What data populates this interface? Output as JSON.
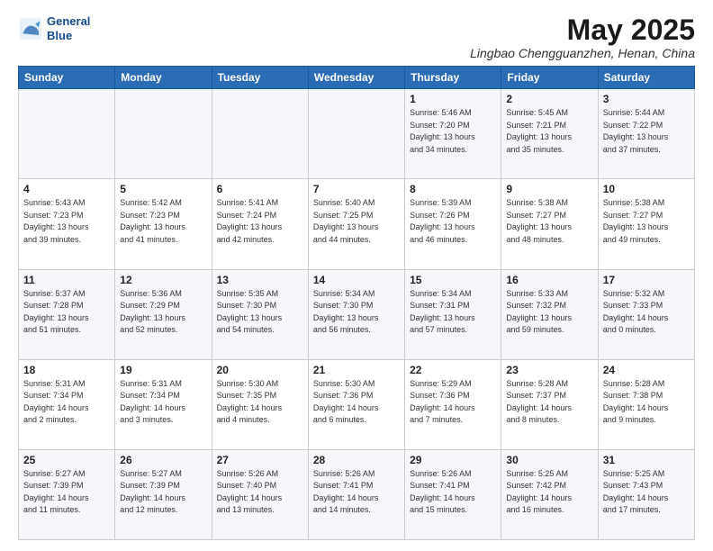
{
  "header": {
    "logo_line1": "General",
    "logo_line2": "Blue",
    "month_title": "May 2025",
    "location": "Lingbao Chengguanzhen, Henan, China"
  },
  "days_of_week": [
    "Sunday",
    "Monday",
    "Tuesday",
    "Wednesday",
    "Thursday",
    "Friday",
    "Saturday"
  ],
  "weeks": [
    [
      {
        "day": "",
        "info": ""
      },
      {
        "day": "",
        "info": ""
      },
      {
        "day": "",
        "info": ""
      },
      {
        "day": "",
        "info": ""
      },
      {
        "day": "1",
        "info": "Sunrise: 5:46 AM\nSunset: 7:20 PM\nDaylight: 13 hours\nand 34 minutes."
      },
      {
        "day": "2",
        "info": "Sunrise: 5:45 AM\nSunset: 7:21 PM\nDaylight: 13 hours\nand 35 minutes."
      },
      {
        "day": "3",
        "info": "Sunrise: 5:44 AM\nSunset: 7:22 PM\nDaylight: 13 hours\nand 37 minutes."
      }
    ],
    [
      {
        "day": "4",
        "info": "Sunrise: 5:43 AM\nSunset: 7:23 PM\nDaylight: 13 hours\nand 39 minutes."
      },
      {
        "day": "5",
        "info": "Sunrise: 5:42 AM\nSunset: 7:23 PM\nDaylight: 13 hours\nand 41 minutes."
      },
      {
        "day": "6",
        "info": "Sunrise: 5:41 AM\nSunset: 7:24 PM\nDaylight: 13 hours\nand 42 minutes."
      },
      {
        "day": "7",
        "info": "Sunrise: 5:40 AM\nSunset: 7:25 PM\nDaylight: 13 hours\nand 44 minutes."
      },
      {
        "day": "8",
        "info": "Sunrise: 5:39 AM\nSunset: 7:26 PM\nDaylight: 13 hours\nand 46 minutes."
      },
      {
        "day": "9",
        "info": "Sunrise: 5:38 AM\nSunset: 7:27 PM\nDaylight: 13 hours\nand 48 minutes."
      },
      {
        "day": "10",
        "info": "Sunrise: 5:38 AM\nSunset: 7:27 PM\nDaylight: 13 hours\nand 49 minutes."
      }
    ],
    [
      {
        "day": "11",
        "info": "Sunrise: 5:37 AM\nSunset: 7:28 PM\nDaylight: 13 hours\nand 51 minutes."
      },
      {
        "day": "12",
        "info": "Sunrise: 5:36 AM\nSunset: 7:29 PM\nDaylight: 13 hours\nand 52 minutes."
      },
      {
        "day": "13",
        "info": "Sunrise: 5:35 AM\nSunset: 7:30 PM\nDaylight: 13 hours\nand 54 minutes."
      },
      {
        "day": "14",
        "info": "Sunrise: 5:34 AM\nSunset: 7:30 PM\nDaylight: 13 hours\nand 56 minutes."
      },
      {
        "day": "15",
        "info": "Sunrise: 5:34 AM\nSunset: 7:31 PM\nDaylight: 13 hours\nand 57 minutes."
      },
      {
        "day": "16",
        "info": "Sunrise: 5:33 AM\nSunset: 7:32 PM\nDaylight: 13 hours\nand 59 minutes."
      },
      {
        "day": "17",
        "info": "Sunrise: 5:32 AM\nSunset: 7:33 PM\nDaylight: 14 hours\nand 0 minutes."
      }
    ],
    [
      {
        "day": "18",
        "info": "Sunrise: 5:31 AM\nSunset: 7:34 PM\nDaylight: 14 hours\nand 2 minutes."
      },
      {
        "day": "19",
        "info": "Sunrise: 5:31 AM\nSunset: 7:34 PM\nDaylight: 14 hours\nand 3 minutes."
      },
      {
        "day": "20",
        "info": "Sunrise: 5:30 AM\nSunset: 7:35 PM\nDaylight: 14 hours\nand 4 minutes."
      },
      {
        "day": "21",
        "info": "Sunrise: 5:30 AM\nSunset: 7:36 PM\nDaylight: 14 hours\nand 6 minutes."
      },
      {
        "day": "22",
        "info": "Sunrise: 5:29 AM\nSunset: 7:36 PM\nDaylight: 14 hours\nand 7 minutes."
      },
      {
        "day": "23",
        "info": "Sunrise: 5:28 AM\nSunset: 7:37 PM\nDaylight: 14 hours\nand 8 minutes."
      },
      {
        "day": "24",
        "info": "Sunrise: 5:28 AM\nSunset: 7:38 PM\nDaylight: 14 hours\nand 9 minutes."
      }
    ],
    [
      {
        "day": "25",
        "info": "Sunrise: 5:27 AM\nSunset: 7:39 PM\nDaylight: 14 hours\nand 11 minutes."
      },
      {
        "day": "26",
        "info": "Sunrise: 5:27 AM\nSunset: 7:39 PM\nDaylight: 14 hours\nand 12 minutes."
      },
      {
        "day": "27",
        "info": "Sunrise: 5:26 AM\nSunset: 7:40 PM\nDaylight: 14 hours\nand 13 minutes."
      },
      {
        "day": "28",
        "info": "Sunrise: 5:26 AM\nSunset: 7:41 PM\nDaylight: 14 hours\nand 14 minutes."
      },
      {
        "day": "29",
        "info": "Sunrise: 5:26 AM\nSunset: 7:41 PM\nDaylight: 14 hours\nand 15 minutes."
      },
      {
        "day": "30",
        "info": "Sunrise: 5:25 AM\nSunset: 7:42 PM\nDaylight: 14 hours\nand 16 minutes."
      },
      {
        "day": "31",
        "info": "Sunrise: 5:25 AM\nSunset: 7:43 PM\nDaylight: 14 hours\nand 17 minutes."
      }
    ]
  ]
}
